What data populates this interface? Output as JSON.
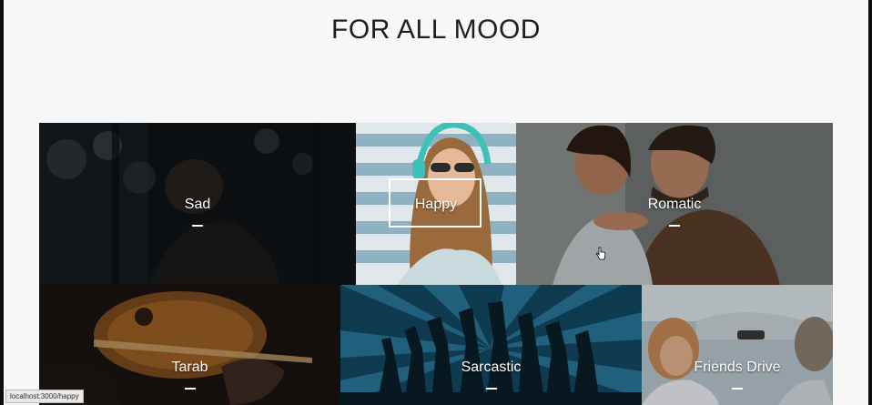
{
  "section": {
    "title": "FOR ALL MOOD"
  },
  "moods": [
    {
      "label": "Sad"
    },
    {
      "label": "Happy"
    },
    {
      "label": "Romatic"
    },
    {
      "label": "Tarab"
    },
    {
      "label": "Sarcastic"
    },
    {
      "label": "Friends Drive"
    }
  ],
  "status_bar": {
    "url": "localhost:3000/happy"
  },
  "colors": {
    "page_background": "#f7f7f7",
    "title_text": "#1f1f1f",
    "tile_text": "#ffffff"
  },
  "icons": {
    "label_dash": "dash-icon",
    "pointer": "hand-cursor-icon"
  }
}
